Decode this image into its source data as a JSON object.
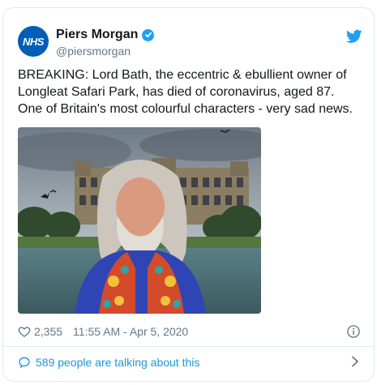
{
  "author": {
    "avatar_text": "NHS",
    "display_name": "Piers Morgan",
    "handle": "@piersmorgan",
    "verified": true
  },
  "tweet": {
    "text": "BREAKING: Lord Bath, the eccentric & ebullient owner of Longleat Safari Park, has died of coronavirus, aged 87. One of Britain's most colourful characters - very sad news."
  },
  "media": {
    "description_icon": "photo"
  },
  "meta": {
    "likes": "2,355",
    "timestamp": "11:55 AM - Apr 5, 2020"
  },
  "footer": {
    "conversation_text": "589 people are talking about this"
  },
  "colors": {
    "twitter_blue": "#1da1f2",
    "link_blue": "#1b95e0",
    "nhs_blue": "#005eb8",
    "secondary_text": "#657786",
    "border": "#e1e8ed"
  }
}
